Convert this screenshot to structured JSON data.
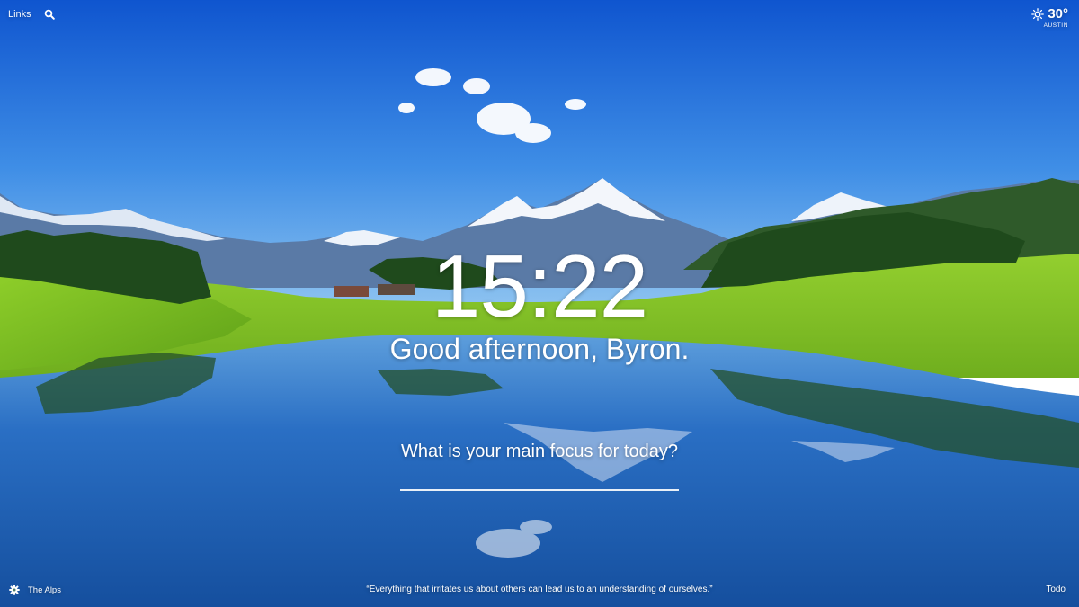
{
  "top_nav": {
    "links_label": "Links",
    "search_icon": "search-icon"
  },
  "weather": {
    "icon": "sun-icon",
    "temperature": "30°",
    "location": "AUSTIN"
  },
  "main": {
    "time": "15:22",
    "greeting": "Good afternoon, Byron.",
    "focus_question": "What is your main focus for today?",
    "focus_value": ""
  },
  "footer": {
    "settings_icon": "gear-icon",
    "photo_location": "The Alps",
    "quote": "“Everything that irritates us about others can lead us to an understanding of ourselves.”",
    "todo_label": "Todo"
  },
  "colors": {
    "text": "#ffffff",
    "sky_top": "#1560d8",
    "sky_horizon": "#7fb8ee",
    "meadow": "#7fc21c",
    "lake": "#1a5fb8"
  }
}
